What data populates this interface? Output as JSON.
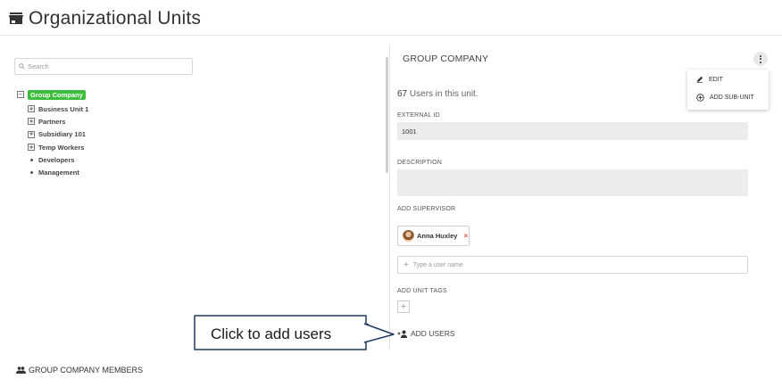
{
  "page": {
    "title": "Organizational Units"
  },
  "search": {
    "placeholder": "Search"
  },
  "tree": {
    "root": {
      "label": "Group Company",
      "toggle": "−"
    },
    "children": [
      {
        "label": "Business Unit 1",
        "type": "expandable",
        "toggle": "+"
      },
      {
        "label": "Partners",
        "type": "expandable",
        "toggle": "+"
      },
      {
        "label": "Subsidiary 101",
        "type": "expandable",
        "toggle": "+"
      },
      {
        "label": "Temp Workers",
        "type": "expandable",
        "toggle": "+"
      },
      {
        "label": "Developers",
        "type": "leaf"
      },
      {
        "label": "Management",
        "type": "leaf"
      }
    ]
  },
  "detail": {
    "title": "GROUP COMPANY",
    "users_count": "67",
    "users_text": "Users in this unit.",
    "external_id_label": "EXTERNAL ID",
    "external_id_value": "1001",
    "description_label": "DESCRIPTION",
    "description_value": "",
    "supervisor_label": "ADD SUPERVISOR",
    "supervisor_name": "Anna Huxley",
    "supervisor_remove": "×",
    "user_input_placeholder": "Type a user name",
    "tags_label": "ADD UNIT TAGS",
    "add_users_label": "ADD USERS"
  },
  "menu": {
    "items": [
      {
        "label": "EDIT",
        "icon": "pencil-icon"
      },
      {
        "label": "ADD SUB-UNIT",
        "icon": "add-circle-icon"
      }
    ]
  },
  "callout": {
    "text": "Click to add users"
  },
  "members": {
    "label": "GROUP COMPANY MEMBERS"
  },
  "colors": {
    "root_highlight": "#3cbe3c",
    "remove_x": "#e05050"
  }
}
